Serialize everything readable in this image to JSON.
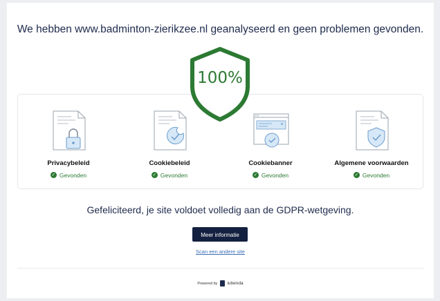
{
  "headline": "We hebben www.badminton-zierikzee.nl geanalyseerd en geen problemen gevonden.",
  "score": "100%",
  "documents": [
    {
      "title": "Privacybeleid",
      "status": "Gevonden",
      "icon": "privacy-policy-lock-icon"
    },
    {
      "title": "Cookiebeleid",
      "status": "Gevonden",
      "icon": "cookie-policy-icon"
    },
    {
      "title": "Cookiebanner",
      "status": "Gevonden",
      "icon": "cookie-banner-icon"
    },
    {
      "title": "Algemene voorwaarden",
      "status": "Gevonden",
      "icon": "terms-shield-icon"
    }
  ],
  "congrats": "Gefeliciteerd, je site voldoet volledig aan de GDPR-wetgeving.",
  "more_info_label": "Meer informatie",
  "scan_other_label": "Scan een andere site",
  "powered_by": "Powered by",
  "brand": "iubenda",
  "colors": {
    "accent_green": "#2c7a33",
    "navy": "#14203f",
    "link_blue": "#3b6fb6",
    "illustration_blue": "#d6e8f7"
  }
}
